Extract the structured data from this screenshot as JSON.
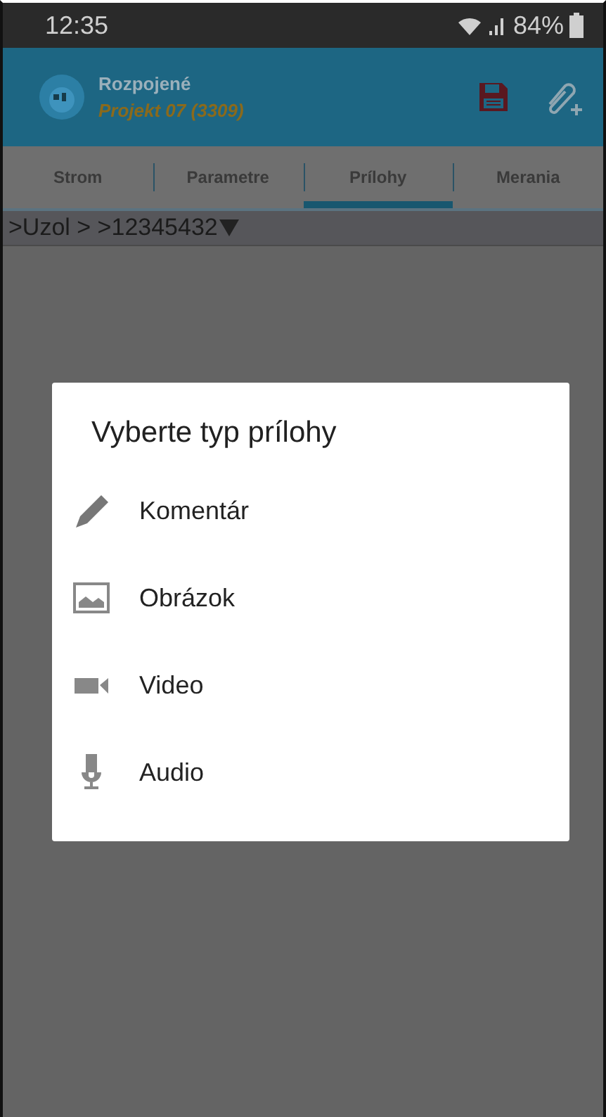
{
  "status_bar": {
    "time": "12:35",
    "battery": "84%"
  },
  "app_bar": {
    "title": "Rozpojené",
    "subtitle": "Projekt 07 (3309)"
  },
  "tabs": [
    {
      "label": "Strom",
      "selected": false
    },
    {
      "label": "Parametre",
      "selected": false
    },
    {
      "label": "Prílohy",
      "selected": true
    },
    {
      "label": "Merania",
      "selected": false
    }
  ],
  "breadcrumb": ">Uzol > >12345432",
  "dialog": {
    "title": "Vyberte typ prílohy",
    "items": [
      {
        "kind": "comment",
        "label": "Komentár"
      },
      {
        "kind": "image",
        "label": "Obrázok"
      },
      {
        "kind": "video",
        "label": "Video"
      },
      {
        "kind": "audio",
        "label": "Audio"
      }
    ]
  }
}
